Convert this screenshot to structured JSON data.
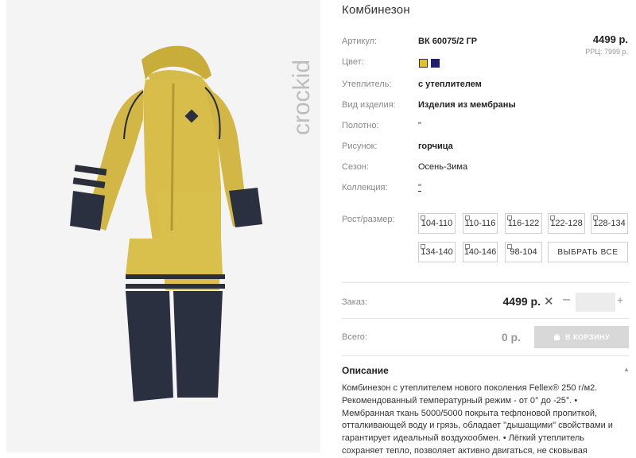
{
  "product": {
    "brand": "crockid",
    "title": "Комбинезон",
    "attributes": [
      {
        "label": "Артикул:",
        "value": "ВК 60075/2 ГР",
        "bold": true
      },
      {
        "label": "Цвет:",
        "value": ""
      },
      {
        "label": "Утеплитель:",
        "value": "с утеплителем",
        "bold": true
      },
      {
        "label": "Вид изделия:",
        "value": "Изделия из мембраны",
        "bold": true
      },
      {
        "label": "Полотно:",
        "value": "\""
      },
      {
        "label": "Рисунок:",
        "value": "горчица",
        "bold": true
      },
      {
        "label": "Сезон:",
        "value": "Осень-Зима"
      },
      {
        "label": "Коллекция:",
        "value": "\""
      }
    ],
    "colors": [
      {
        "name": "yellow",
        "hex": "#e6c21c"
      },
      {
        "name": "navy",
        "hex": "#1d1d6e"
      }
    ],
    "price": "4499 р.",
    "rrp": "РРЦ: 7999 р.",
    "size_label": "Рост/размер:",
    "sizes": [
      "104-110",
      "110-116",
      "116-122",
      "122-128",
      "128-134",
      "134-140",
      "140-146",
      "98-104"
    ],
    "select_all": "ВЫБРАТЬ ВСЕ"
  },
  "order": {
    "label": "Заказ:",
    "price": "4499 р.",
    "remove": "✕",
    "minus": "–",
    "plus": "+",
    "quantity": ""
  },
  "total": {
    "label": "Всего:",
    "value": "0 р.",
    "cart_button": "В КОРЗИНУ"
  },
  "description": {
    "heading": "Описание",
    "text": "Комбинезон с утеплителем нового поколения Fellex® 250 г/м2. Рекомендованный температурный режим - от 0° до -25°. • Мембранная ткань 5000/5000 покрыта тефлоновой пропиткой, отталкивающей воду и грязь, обладает \"дышащими\" свойствами и гарантирует идеальный воздухообмен. • Лёгкий утеплитель сохраняет тепло, позволяет активно двигаться, не сковывая"
  }
}
